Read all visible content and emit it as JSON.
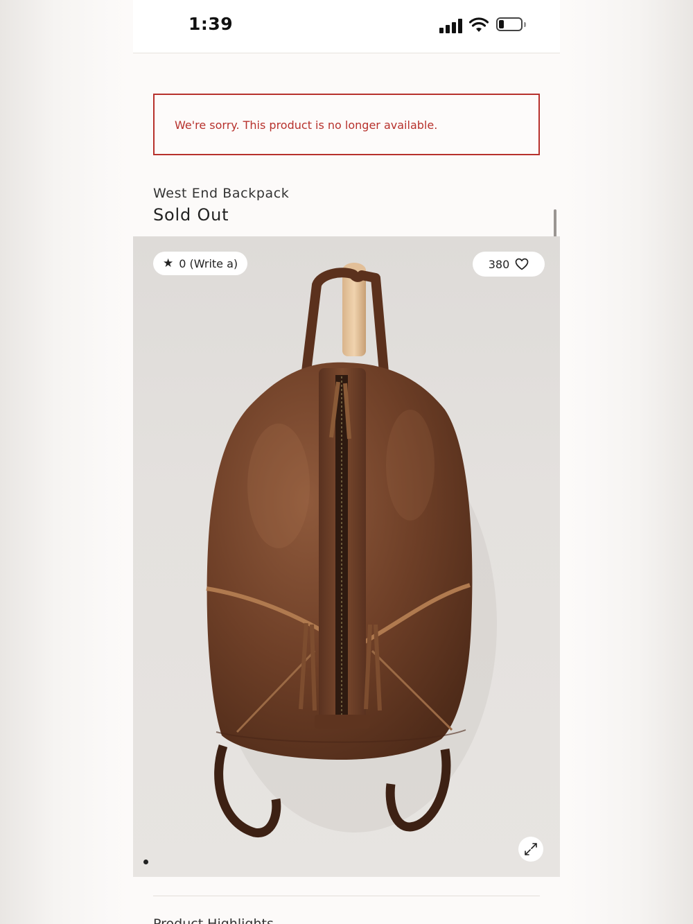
{
  "status_bar": {
    "time": "1:39",
    "battery_level": 0.2
  },
  "alert": {
    "message": "We're sorry. This product is no longer available.",
    "color": "#b7312c"
  },
  "product": {
    "name": "West End Backpack",
    "availability": "Sold Out"
  },
  "gallery": {
    "rating_label": "0 (Write a)",
    "favorites_count": "380",
    "image_alt": "West End Backpack",
    "current_slide": 1,
    "leather_color": "#6e3f27"
  },
  "sections": {
    "highlights_title": "Product Highlights"
  },
  "icons": [
    "signal-icon",
    "wifi-icon",
    "battery-icon",
    "star-icon",
    "heart-icon",
    "expand-icon"
  ]
}
